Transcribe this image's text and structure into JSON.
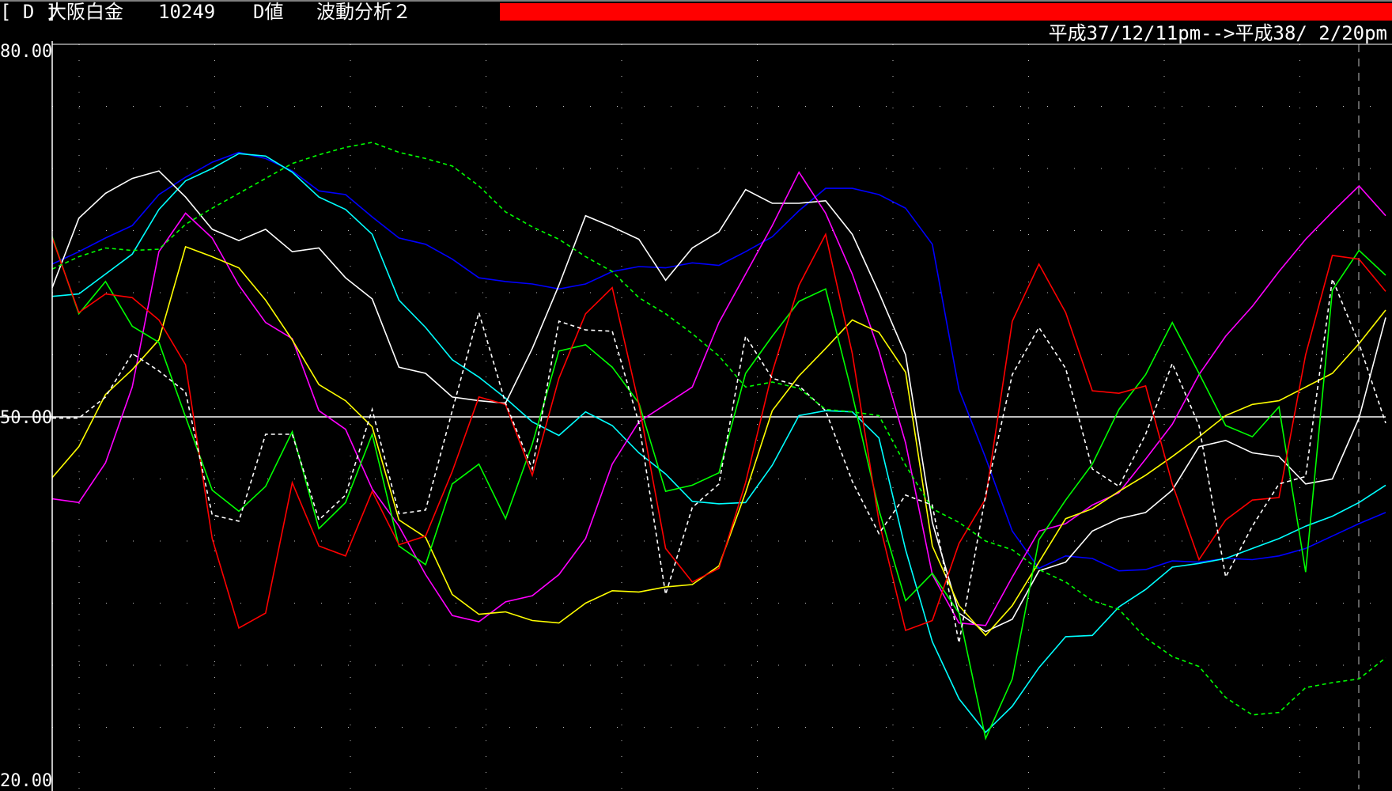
{
  "header": {
    "bracket": "[ D ]",
    "instrument": "大阪白金",
    "code": "10249",
    "mode": "D値",
    "analysis": "波動分析２",
    "date_range": "平成37/12/11pm-->平成38/ 2/20pm"
  },
  "colors": {
    "background": "#000000",
    "grid": "#bfbfbf",
    "reference_line": "#ffffff",
    "status_bar": "#ff0000"
  },
  "chart_data": {
    "type": "line",
    "ylim": [
      20.0,
      80.0
    ],
    "yticks": [
      {
        "value": 80.0,
        "label": "80.00"
      },
      {
        "value": 50.0,
        "label": "50.00"
      },
      {
        "value": 20.0,
        "label": "20.00"
      }
    ],
    "reference_line": 50.0,
    "grid": true,
    "x": [
      0,
      1,
      2,
      3,
      4,
      5,
      6,
      7,
      8,
      9,
      10,
      11,
      12,
      13,
      14,
      15,
      16,
      17,
      18,
      19,
      20,
      21,
      22,
      23,
      24,
      25,
      26,
      27,
      28,
      29,
      30,
      31,
      32,
      33,
      34,
      35,
      36,
      37,
      38,
      39,
      40,
      41,
      42,
      43,
      44,
      45,
      46,
      47,
      48,
      49,
      50
    ],
    "series": [
      {
        "color": "#0000ff",
        "dashed": false,
        "values": [
          62.3,
          63.3,
          64.4,
          65.4,
          67.9,
          69.3,
          70.5,
          71.3,
          70.8,
          69.8,
          68.2,
          67.9,
          66.1,
          64.4,
          63.9,
          62.7,
          61.2,
          60.9,
          60.7,
          60.3,
          60.7,
          61.7,
          62.1,
          62.0,
          62.4,
          62.2,
          63.3,
          64.5,
          66.6,
          68.4,
          68.4,
          67.9,
          66.8,
          63.9,
          52.2,
          46.7,
          40.8,
          37.8,
          38.8,
          38.6,
          37.6,
          37.7,
          38.4,
          38.3,
          38.6,
          38.5,
          38.8,
          39.4,
          40.4,
          41.4,
          42.3
        ]
      },
      {
        "color": "#00ffff",
        "dashed": false,
        "values": [
          59.7,
          59.9,
          61.5,
          63.1,
          66.7,
          69.0,
          70.0,
          71.2,
          71.0,
          69.7,
          67.7,
          66.7,
          64.7,
          59.4,
          57.2,
          54.6,
          53.2,
          51.5,
          49.6,
          48.5,
          50.4,
          49.3,
          47.1,
          45.4,
          43.2,
          43.0,
          43.1,
          46.1,
          50.1,
          50.5,
          50.4,
          48.3,
          39.3,
          31.9,
          27.3,
          24.6,
          26.7,
          29.8,
          32.3,
          32.4,
          34.7,
          36.1,
          37.9,
          38.2,
          38.6,
          39.4,
          40.2,
          41.2,
          42.0,
          43.1,
          44.5
        ]
      },
      {
        "color": "#ffffff",
        "dashed": false,
        "values": [
          60.4,
          66.0,
          68.0,
          69.2,
          69.8,
          67.7,
          65.1,
          64.2,
          65.1,
          63.3,
          63.6,
          61.2,
          59.5,
          54.0,
          53.5,
          51.6,
          51.3,
          51.1,
          55.5,
          60.6,
          66.2,
          65.3,
          64.3,
          61.0,
          63.6,
          64.9,
          68.3,
          67.2,
          67.2,
          67.4,
          64.7,
          60.0,
          55.0,
          41.5,
          34.2,
          32.7,
          33.7,
          37.6,
          38.3,
          40.8,
          41.8,
          42.3,
          44.1,
          47.6,
          48.1,
          47.1,
          46.8,
          44.6,
          45.0,
          49.9,
          58.0
        ]
      },
      {
        "color": "#ff00ff",
        "dashed": false,
        "values": [
          43.4,
          43.1,
          46.3,
          52.4,
          63.3,
          66.4,
          64.4,
          60.6,
          57.6,
          56.3,
          50.5,
          49.0,
          44.2,
          41.2,
          37.3,
          34.0,
          33.5,
          35.1,
          35.6,
          37.3,
          40.2,
          46.2,
          49.6,
          51.0,
          52.4,
          57.6,
          61.5,
          65.4,
          69.7,
          66.4,
          61.5,
          55.3,
          47.9,
          37.3,
          33.4,
          33.2,
          37.1,
          40.8,
          41.4,
          42.9,
          43.9,
          46.6,
          49.4,
          53.4,
          56.5,
          58.9,
          61.7,
          64.3,
          66.5,
          68.6,
          66.2
        ]
      },
      {
        "color": "#ffff00",
        "dashed": false,
        "values": [
          45.1,
          47.6,
          51.8,
          53.8,
          56.2,
          63.7,
          62.9,
          62.0,
          59.4,
          56.2,
          52.6,
          51.3,
          49.2,
          41.7,
          40.3,
          35.7,
          34.1,
          34.3,
          33.6,
          33.4,
          35.0,
          36.0,
          35.9,
          36.3,
          36.5,
          38.0,
          43.9,
          50.5,
          53.3,
          55.5,
          57.8,
          56.8,
          53.6,
          39.6,
          34.8,
          32.4,
          34.8,
          38.3,
          41.8,
          42.6,
          44.0,
          45.3,
          46.8,
          48.4,
          50.1,
          51.0,
          51.3,
          52.4,
          53.5,
          55.9,
          58.6
        ]
      },
      {
        "color": "#00ff00",
        "dashed": false,
        "values": [
          64.5,
          58.3,
          60.9,
          57.3,
          56.0,
          50.0,
          44.1,
          42.4,
          44.4,
          48.8,
          41.0,
          43.1,
          48.6,
          39.6,
          38.1,
          44.6,
          46.2,
          41.8,
          47.8,
          55.3,
          55.8,
          54.0,
          51.1,
          44.0,
          44.5,
          45.5,
          53.5,
          56.5,
          59.3,
          60.3,
          51.8,
          42.5,
          35.2,
          37.4,
          34.2,
          24.1,
          28.9,
          40.1,
          43.3,
          46.2,
          50.6,
          53.4,
          57.6,
          53.5,
          49.3,
          48.4,
          50.8,
          37.5,
          60.2,
          63.4,
          61.4
        ]
      },
      {
        "color": "#ff0000",
        "dashed": false,
        "values": [
          64.4,
          58.4,
          59.9,
          59.6,
          57.8,
          54.2,
          40.2,
          33.0,
          34.2,
          44.7,
          39.6,
          38.8,
          44.0,
          39.7,
          40.4,
          45.6,
          51.6,
          51.0,
          45.3,
          53.1,
          58.3,
          60.4,
          51.0,
          39.4,
          36.7,
          37.8,
          44.7,
          53.6,
          60.6,
          64.7,
          55.1,
          41.6,
          32.8,
          33.6,
          39.8,
          43.4,
          57.7,
          62.3,
          58.4,
          52.1,
          51.9,
          52.5,
          44.6,
          38.5,
          41.7,
          43.3,
          43.5,
          55.0,
          63.0,
          62.7,
          60.1
        ]
      },
      {
        "color": "#ffffff",
        "dashed": true,
        "values": [
          49.9,
          49.9,
          51.6,
          55.1,
          53.7,
          52.0,
          42.1,
          41.6,
          48.6,
          48.6,
          41.7,
          43.7,
          50.6,
          42.2,
          42.5,
          50.5,
          58.4,
          51.1,
          45.8,
          57.7,
          57.0,
          56.9,
          49.5,
          35.7,
          42.7,
          44.6,
          56.5,
          53.1,
          52.5,
          50.5,
          44.8,
          40.6,
          43.7,
          42.9,
          31.8,
          43.7,
          53.4,
          57.2,
          53.9,
          45.8,
          44.4,
          48.6,
          54.3,
          49.3,
          37.1,
          41.2,
          44.6,
          45.2,
          61.1,
          55.9,
          49.5
        ]
      },
      {
        "color": "#00ff00",
        "dashed": true,
        "values": [
          61.9,
          62.9,
          63.6,
          63.4,
          63.5,
          65.5,
          66.8,
          68.0,
          69.2,
          70.4,
          71.1,
          71.7,
          72.1,
          71.3,
          70.8,
          70.2,
          68.6,
          66.5,
          65.3,
          64.3,
          62.9,
          61.7,
          59.6,
          58.3,
          56.7,
          54.9,
          52.4,
          52.8,
          52.3,
          50.6,
          50.4,
          50.1,
          46.1,
          42.6,
          41.5,
          40.0,
          39.3,
          37.7,
          36.7,
          35.2,
          34.5,
          32.2,
          30.7,
          29.9,
          27.4,
          26.0,
          26.2,
          28.2,
          28.6,
          28.9,
          30.6
        ]
      }
    ]
  }
}
